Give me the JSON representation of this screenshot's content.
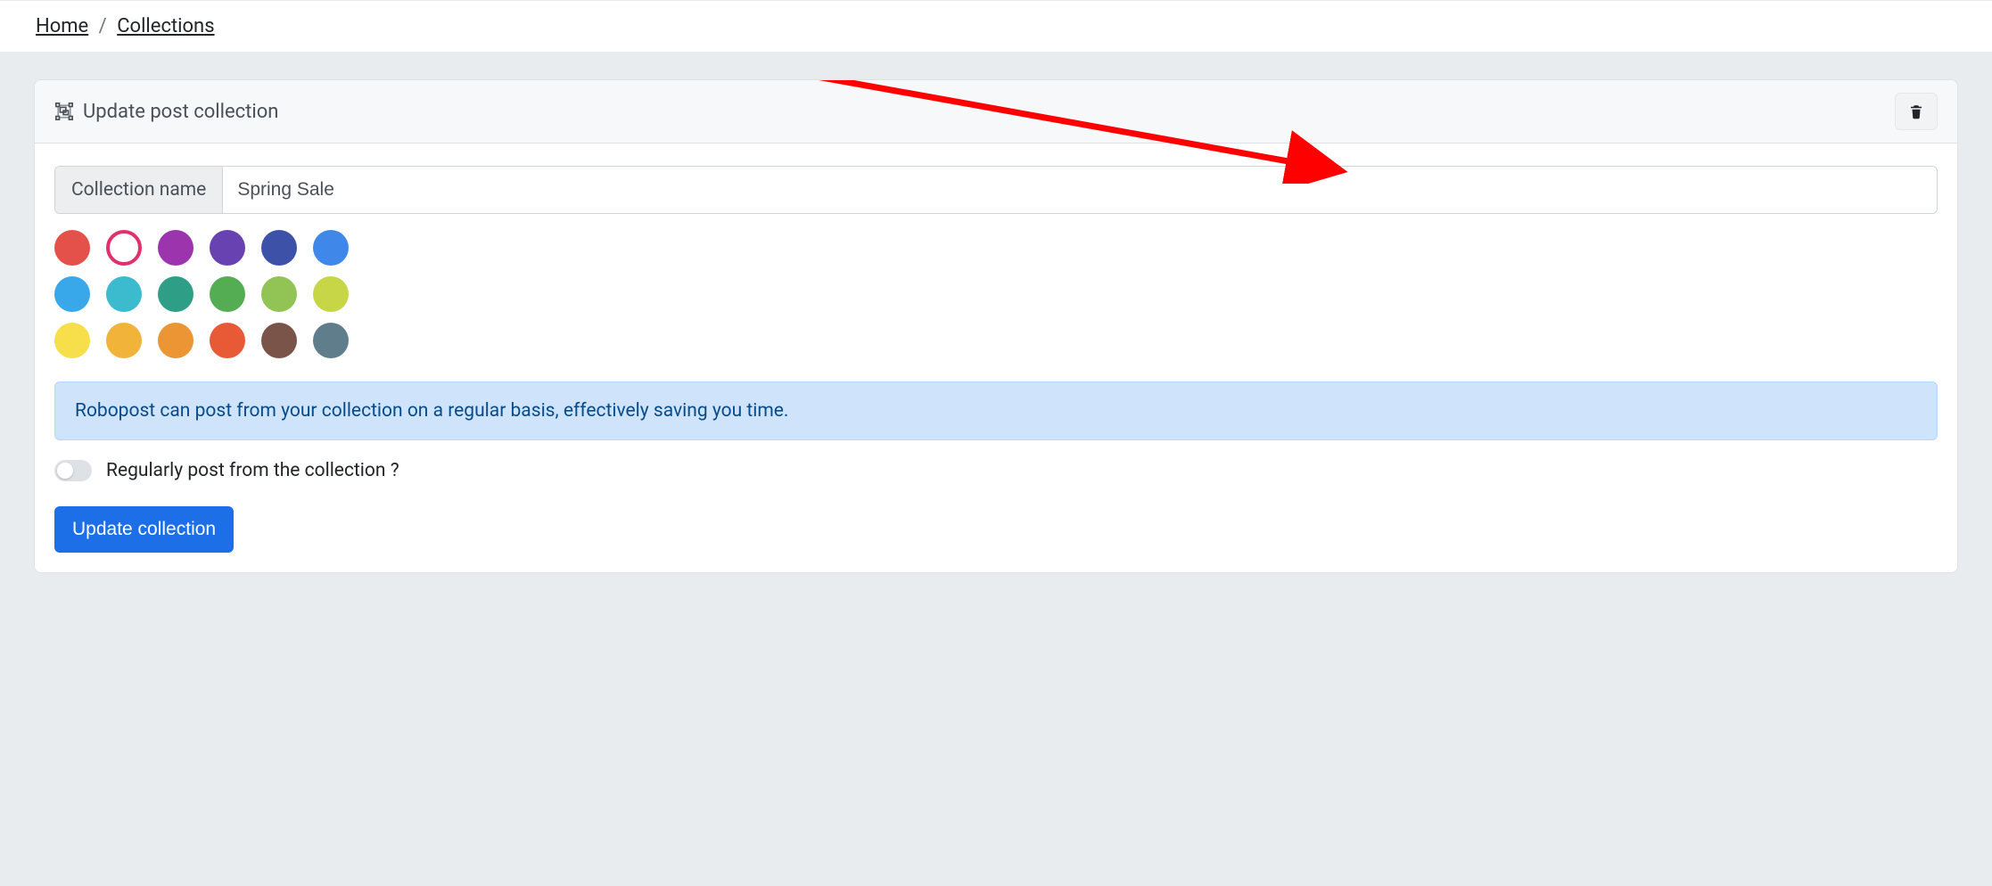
{
  "breadcrumb": {
    "home": "Home",
    "collections": "Collections"
  },
  "header": {
    "title": "Update post collection"
  },
  "form": {
    "name_label": "Collection name",
    "name_value": "Spring Sale",
    "colors": {
      "row1": [
        "#e4514a",
        "hollow",
        "#9c34ae",
        "#6742b0",
        "#3d51a9",
        "#3f88e9"
      ],
      "row2": [
        "#38a8ea",
        "#3dbbce",
        "#2f9e87",
        "#55ad53",
        "#92c455",
        "#c7d647"
      ],
      "row3": [
        "#f7df4c",
        "#f2b33a",
        "#ec9535",
        "#e85935",
        "#7a5449",
        "#607d8b"
      ]
    },
    "info_text": "Robopost can post from your collection on a regular basis, effectively saving you time.",
    "toggle_label": "Regularly post from the collection ?",
    "submit_label": "Update collection"
  }
}
